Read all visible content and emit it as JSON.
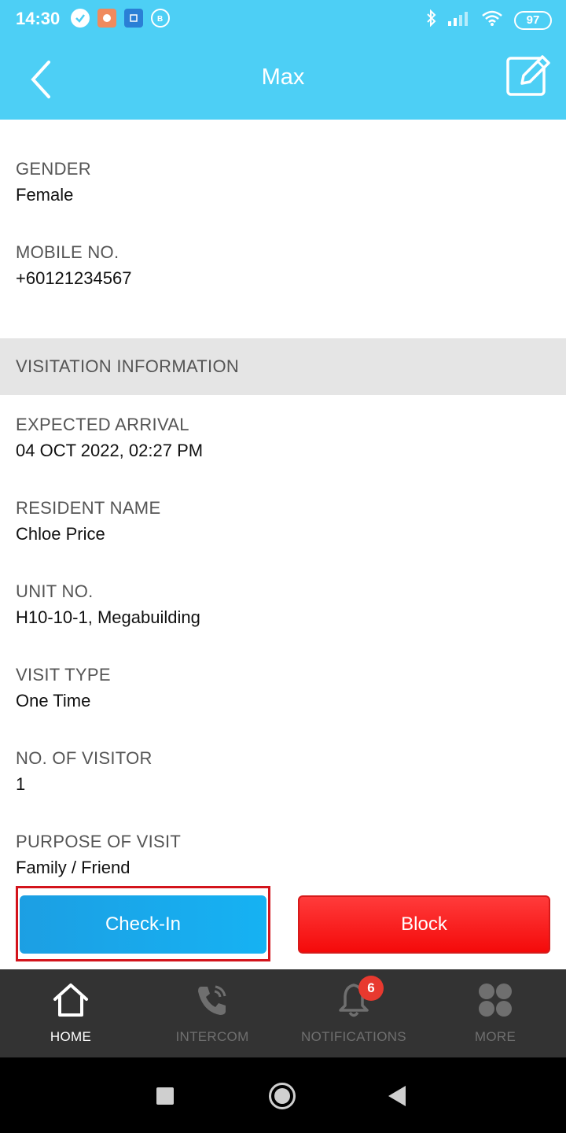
{
  "status_bar": {
    "time": "14:30",
    "battery": "97",
    "left_icons": [
      "check-circle-icon",
      "app-notification-icon",
      "app-square-icon",
      "chat-b-icon"
    ],
    "right_icons": [
      "bluetooth-icon",
      "signal-icon",
      "wifi-icon"
    ]
  },
  "header": {
    "title": "Max",
    "back_icon": "chevron-left-icon",
    "edit_icon": "edit-icon"
  },
  "visitor_details": {
    "gender_label": "GENDER",
    "gender_value": "Female",
    "mobile_label": "MOBILE NO.",
    "mobile_value": "+60121234567"
  },
  "visitation": {
    "section_title": "VISITATION INFORMATION",
    "fields": [
      {
        "label": "EXPECTED ARRIVAL",
        "value": "04 OCT 2022, 02:27 PM"
      },
      {
        "label": "RESIDENT NAME",
        "value": "Chloe Price"
      },
      {
        "label": "UNIT NO.",
        "value": "H10-10-1, Megabuilding"
      },
      {
        "label": "VISIT TYPE",
        "value": "One Time"
      },
      {
        "label": "NO. OF VISITOR",
        "value": "1"
      },
      {
        "label": "PURPOSE OF VISIT",
        "value": "Family / Friend"
      }
    ]
  },
  "actions": {
    "checkin_label": "Check-In",
    "block_label": "Block",
    "checkin_color": "#16b2f3",
    "block_color": "#f40a0a",
    "highlight_color": "#d3141c"
  },
  "bottom_nav": {
    "items": [
      {
        "label": "HOME",
        "icon": "home-icon",
        "active": true
      },
      {
        "label": "INTERCOM",
        "icon": "phone-icon",
        "active": false
      },
      {
        "label": "NOTIFICATIONS",
        "icon": "bell-icon",
        "active": false,
        "badge": "6"
      },
      {
        "label": "MORE",
        "icon": "grid-dots-icon",
        "active": false
      }
    ]
  },
  "colors": {
    "header_bg": "#4dcff5",
    "section_bg": "#e5e5e5",
    "nav_bg": "#333333"
  }
}
